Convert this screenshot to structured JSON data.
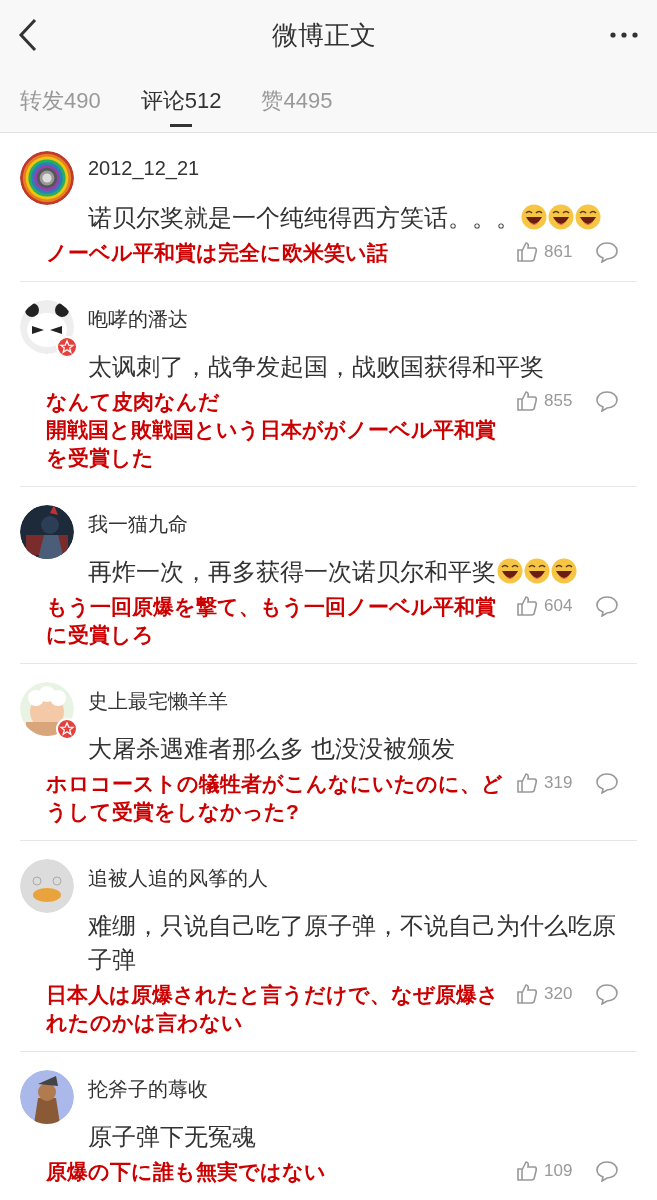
{
  "header": {
    "title": "微博正文"
  },
  "tabs": [
    {
      "label": "转发490",
      "selected": false
    },
    {
      "label": "评论512",
      "selected": true
    },
    {
      "label": "赞4495",
      "selected": false
    }
  ],
  "comments": [
    {
      "name": "2012_12_21",
      "verified": false,
      "avatar": {
        "kind": "picture"
      },
      "text": "诺贝尔奖就是一个纯纯得西方笑话。。。",
      "emojis": [
        {
          "kind": "laugh"
        },
        {
          "kind": "laugh"
        },
        {
          "kind": "laugh"
        }
      ],
      "annotations": [
        "ノーベル平和賞は完全に欧米笑い話"
      ],
      "likes": "861"
    },
    {
      "name": "咆哮的潘达",
      "verified": true,
      "avatar": {
        "kind": "picture"
      },
      "text": "太讽刺了，战争发起国，战败国获得和平奖",
      "annotations": [
        "なんて皮肉なんだ",
        "開戦国と敗戦国という日本ががノーベル平和賞を受賞した"
      ],
      "likes": "855"
    },
    {
      "name": "我一猫九命",
      "verified": false,
      "avatar": {
        "kind": "picture"
      },
      "text": "再炸一次，再多获得一次诺贝尔和平奖",
      "emojis": [
        {
          "kind": "laugh"
        },
        {
          "kind": "laugh"
        },
        {
          "kind": "laugh"
        }
      ],
      "annotations": [
        "もう一回原爆を撃て、もう一回ノーベル平和賞に受賞しろ"
      ],
      "likes": "604"
    },
    {
      "name": "史上最宅懒羊羊",
      "verified": true,
      "avatar": {
        "kind": "picture"
      },
      "text": "大屠杀遇难者那么多 也没没被颁发",
      "annotations": [
        "ホロコーストの犠牲者がこんなにいたのに、どうして受賞をしなかった?"
      ],
      "likes": "319"
    },
    {
      "name": "追被人追的风筝的人",
      "verified": false,
      "avatar": {
        "kind": "picture"
      },
      "text": "难绷，只说自己吃了原子弹，不说自己为什么吃原子弹",
      "annotations": [
        "日本人は原爆されたと言うだけで、なぜ原爆されたのかは言わない"
      ],
      "likes": "320"
    },
    {
      "name": "抡斧子的蓐收",
      "verified": false,
      "avatar": {
        "kind": "picture"
      },
      "text": "原子弹下无冤魂",
      "annotations": [
        "原爆の下に誰も無実ではない"
      ],
      "likes": "109"
    }
  ]
}
